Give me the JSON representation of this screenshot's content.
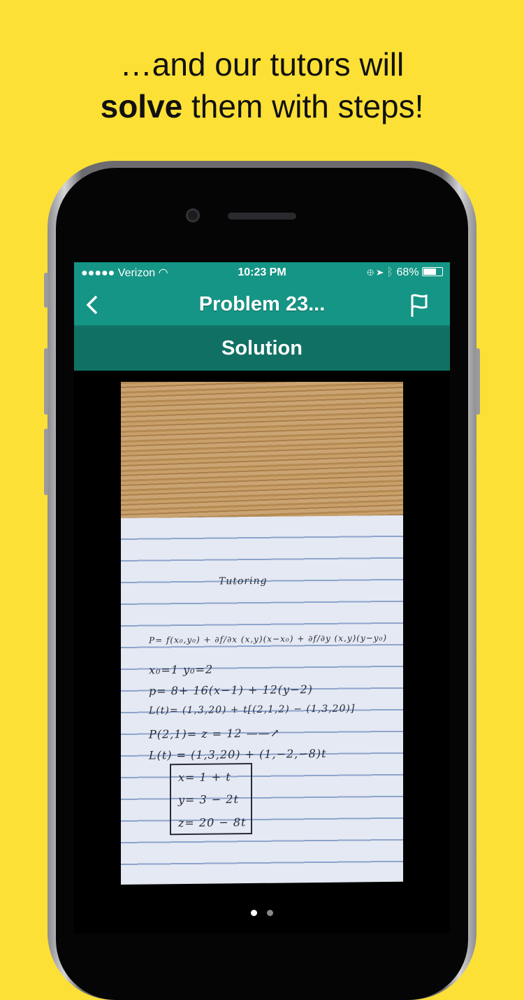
{
  "headline": {
    "line1": "…and our tutors will",
    "bold": "solve",
    "line2_rest": " them with steps!"
  },
  "status": {
    "signal": "●●●●●",
    "carrier": "Verizon",
    "time": "10:23 PM",
    "battery": "68%"
  },
  "nav": {
    "title": "Problem 23...",
    "back_icon": "chevron-left-icon",
    "flag_icon": "flag-icon"
  },
  "subheader": "Solution",
  "photo": {
    "title": "Tutoring",
    "lines": [
      "P= f(x₀,y₀) + ∂f/∂x (x,y)(x−x₀) + ∂f/∂y (x,y)(y−y₀)",
      "x₀=1        y₀=2",
      "p= 8+  16(x−1)  +  12(y−2)",
      "L(t)= (1,3,20) + t[(2,1,2) − (1,3,20)]",
      "P(2,1)= z = 12 ——↗",
      "L(t) = (1,3,20) + (1,−2,−8)t"
    ],
    "boxed": [
      "x=  1 + t",
      "y=  3 − 2t",
      "z=  20 − 8t"
    ]
  },
  "pager": {
    "count": 2,
    "active": 0
  },
  "colors": {
    "background": "#fde036",
    "nav": "#159585",
    "subbar": "#117064"
  }
}
